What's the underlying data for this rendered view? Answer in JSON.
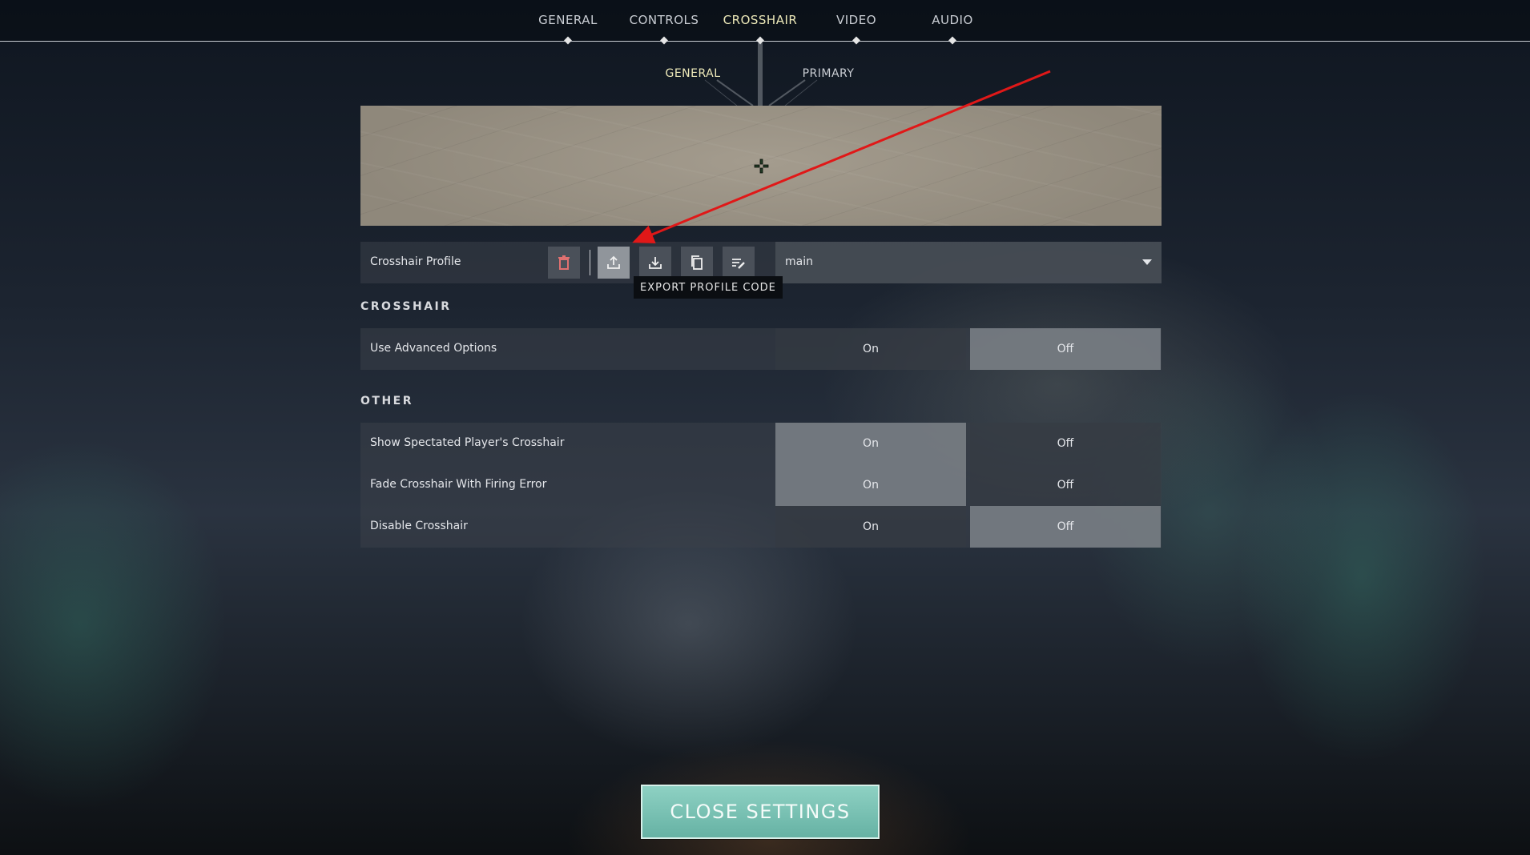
{
  "tabs": [
    {
      "label": "GENERAL",
      "active": false
    },
    {
      "label": "CONTROLS",
      "active": false
    },
    {
      "label": "CROSSHAIR",
      "active": true
    },
    {
      "label": "VIDEO",
      "active": false
    },
    {
      "label": "AUDIO",
      "active": false
    }
  ],
  "subtabs": [
    {
      "label": "GENERAL",
      "active": true
    },
    {
      "label": "PRIMARY",
      "active": false
    }
  ],
  "profile": {
    "label": "Crosshair Profile",
    "selected": "main",
    "tools": [
      "trash-icon",
      "export-icon",
      "import-icon",
      "copy-icon",
      "rename-icon"
    ],
    "tooltip": "EXPORT PROFILE CODE"
  },
  "sections": {
    "crosshair": {
      "title": "CROSSHAIR",
      "rows": [
        {
          "label": "Use Advanced Options",
          "on": "On",
          "off": "Off",
          "value": "Off"
        }
      ]
    },
    "other": {
      "title": "OTHER",
      "rows": [
        {
          "label": "Show Spectated Player's Crosshair",
          "on": "On",
          "off": "Off",
          "value": "On"
        },
        {
          "label": "Fade Crosshair With Firing Error",
          "on": "On",
          "off": "Off",
          "value": "On"
        },
        {
          "label": "Disable Crosshair",
          "on": "On",
          "off": "Off",
          "value": "Off"
        }
      ]
    }
  },
  "close_button": "CLOSE SETTINGS",
  "colors": {
    "active_tab": "#ece8b8",
    "close_button": "#7cc3b5",
    "annotation_arrow": "#e01818"
  }
}
